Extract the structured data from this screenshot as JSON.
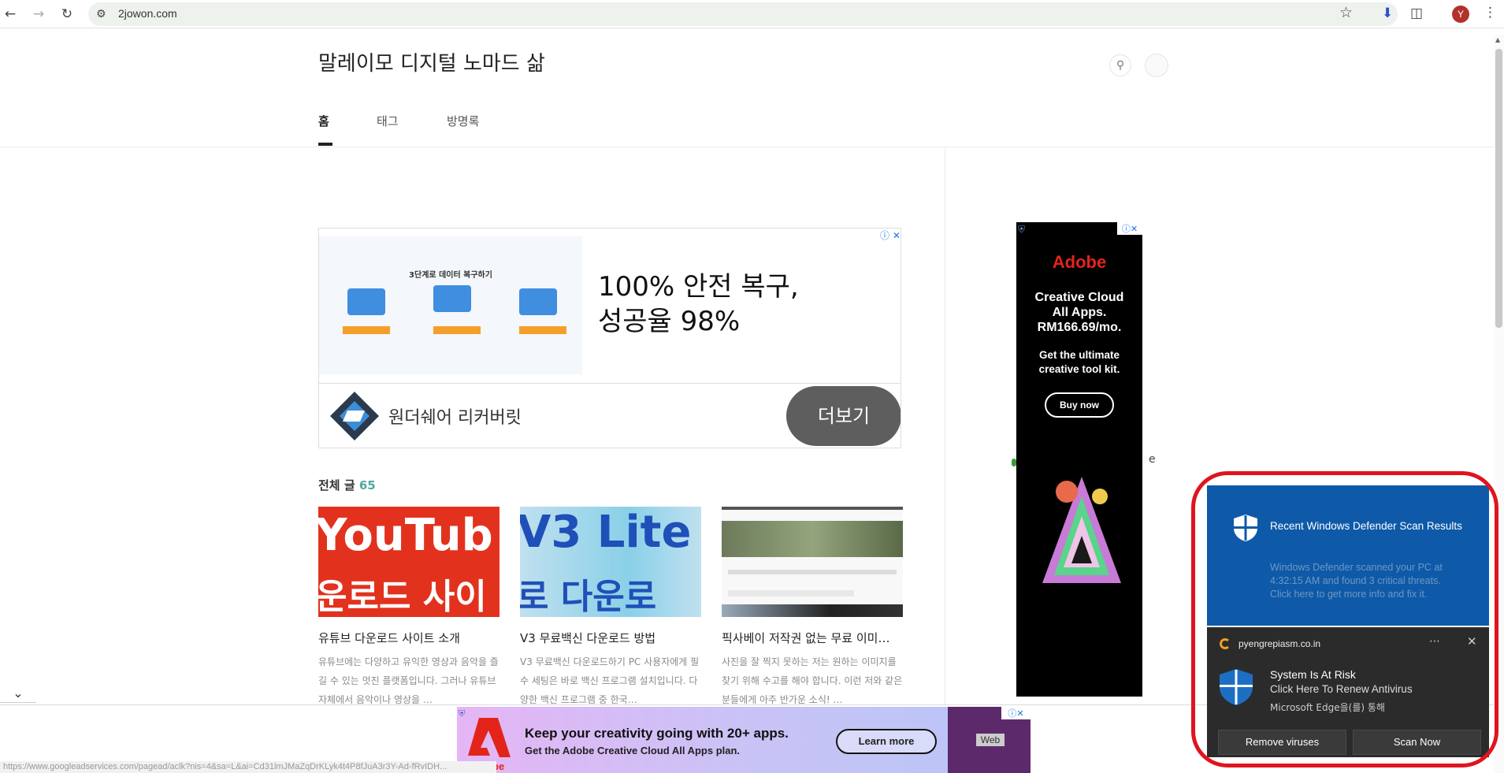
{
  "browser": {
    "url": "2jowon.com",
    "avatar_letter": "Y",
    "status_url": "https://www.googleadservices.com/pagead/aclk?nis=4&sa=L&ai=Cd31lmJMaZqDrKLyk4t4P8fJuA3r3Y-Ad-fRvIDH..."
  },
  "blog": {
    "title": "말레이모 디지털 노마드 삶",
    "nav": [
      "홈",
      "태그",
      "방명록"
    ],
    "posts_label": "전체 글",
    "posts_count": "65"
  },
  "ad_top": {
    "image_title": "3단계로 데이터 복구하기",
    "headline_line1": "100% 안전 복구,",
    "headline_line2": "성공율 98%",
    "brand": "원더쉐어 리커버릿",
    "button": "더보기"
  },
  "posts": [
    {
      "thumb_line1": "YouTub",
      "thumb_line2": "운로드 사이",
      "title": "유튜브 다운로드 사이트 소개",
      "desc": "유튜브에는 다양하고 유익한 영상과 음악을 즐길 수 있는 멋진 플랫폼입니다. 그러나 유튜브 자체에서 음악이나 영상을 …"
    },
    {
      "thumb_line1": "V3 Lite",
      "thumb_line2": "로 다운로",
      "title": "V3 무료백신 다운로드 방법",
      "desc": "V3 무료백신 다운로드하기 PC 사용자에게 필수 세팅은 바로 백신 프로그램 설치입니다. 다양한 백신 프로그램 중 한국…"
    },
    {
      "title": "픽사베이 저작권 없는 무료 이미…",
      "desc": "사진을 잘 찍지 못하는 저는 원하는 이미지를 찾기 위해 수고를 해야 합니다. 이런 저와 같은 분들에게 아주 반가운 소식! …"
    }
  ],
  "side_ad": {
    "logo": "Adobe",
    "headline_lines": [
      "Creative Cloud",
      "All Apps.",
      "RM166.69/mo."
    ],
    "sub_lines": [
      "Get the ultimate",
      "creative tool kit."
    ],
    "button": "Buy now"
  },
  "bottom_ad": {
    "logo": "Adobe",
    "headline": "Keep your creativity going with 20+ apps.",
    "sub": "Get the Adobe Creative Cloud All Apps plan.",
    "button": "Learn more",
    "thumb_label": "Web"
  },
  "defender_notice": {
    "title": "Recent Windows Defender Scan Results",
    "text_lines": [
      "Windows Defender scanned your PC at",
      "4:32:15 AM and found 3 critical threats.",
      "Click here to get more info and fix it."
    ]
  },
  "toast": {
    "site": "pyengrepiasm.co.in",
    "title": "System Is At Risk",
    "line2": "Click Here To Renew Antivirus",
    "line3": "Microsoft Edge을(를) 통해",
    "buttons": [
      "Remove viruses",
      "Scan Now"
    ]
  },
  "colors": {
    "accent_count": "#52a7a3",
    "defender_blue": "#0e5aa8",
    "alert_ring": "#e0141e",
    "adobe_red": "#e3241b"
  }
}
